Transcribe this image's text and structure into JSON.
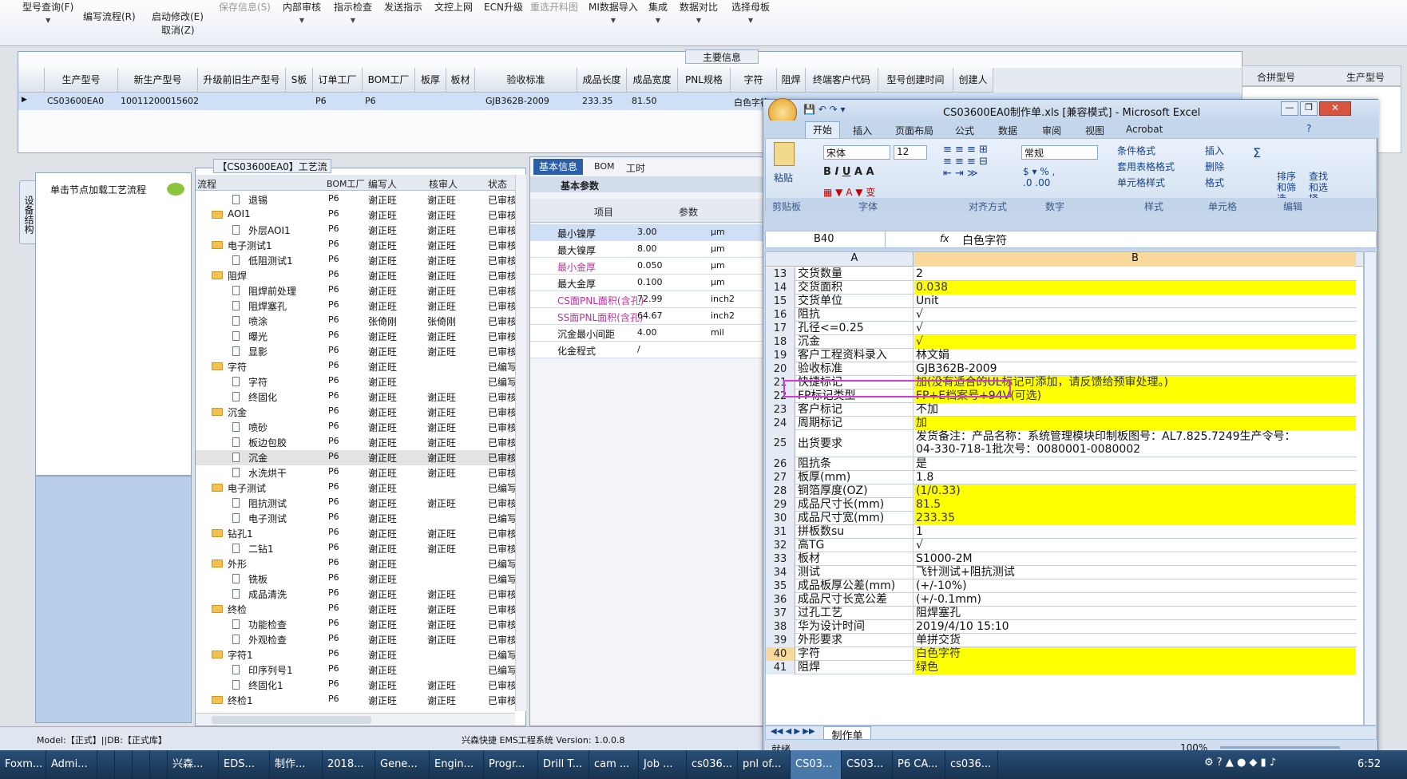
{
  "toolbar": {
    "items": [
      {
        "label": "型号查询(F)",
        "disabled": false
      },
      {
        "label": "编写流程(R)",
        "disabled": false
      },
      {
        "label": "启动修改(E)",
        "disabled": false
      },
      {
        "label": "取消(Z)",
        "disabled": false
      },
      {
        "label": "保存信息(S)",
        "disabled": true
      },
      {
        "label": "内部审核",
        "disabled": false
      },
      {
        "label": "指示检查",
        "disabled": false
      },
      {
        "label": "发送指示",
        "disabled": false
      },
      {
        "label": "文控上网",
        "disabled": false
      },
      {
        "label": "ECN升级",
        "disabled": false
      },
      {
        "label": "重选开料图",
        "disabled": true
      },
      {
        "label": "MI数据导入",
        "disabled": false
      },
      {
        "label": "集成",
        "disabled": false
      },
      {
        "label": "数据对比",
        "disabled": false
      },
      {
        "label": "选择母板",
        "disabled": false
      }
    ]
  },
  "main_info": {
    "title": "主要信息",
    "columns": [
      "生产型号",
      "新生产型号",
      "升级前旧生产型号",
      "S板",
      "订单工厂",
      "BOM工厂",
      "板厚",
      "板材",
      "验收标准",
      "成品长度",
      "成品宽度",
      "PNL规格",
      "字符",
      "阻焊",
      "终端客户代码",
      "型号创建时间",
      "创建人"
    ],
    "row": [
      "CS03600EA0",
      "10011200015602",
      "",
      "",
      "P6",
      "P6",
      "",
      "",
      "GJB362B-2009",
      "233.35",
      "81.50",
      "",
      "白色字符",
      "",
      "",
      "",
      ""
    ],
    "extra_columns": [
      "合拼型号",
      "生产型号"
    ]
  },
  "side_tab": "设备结构",
  "left_panel": {
    "hint": "单击节点加载工艺流程"
  },
  "process_flow": {
    "title": "【CS03600EA0】工艺流程",
    "columns": [
      "流程",
      "BOM工厂",
      "编写人",
      "核审人",
      "状态"
    ],
    "rows": [
      {
        "name": "退锡",
        "level": 2,
        "bom": "P6",
        "writer": "谢正旺",
        "reviewer": "谢正旺",
        "status": "已审核"
      },
      {
        "name": "AOI1",
        "level": 1,
        "bom": "P6",
        "writer": "谢正旺",
        "reviewer": "谢正旺",
        "status": "已审核"
      },
      {
        "name": "外层AOI1",
        "level": 2,
        "bom": "P6",
        "writer": "谢正旺",
        "reviewer": "谢正旺",
        "status": "已审核"
      },
      {
        "name": "电子测试1",
        "level": 1,
        "bom": "P6",
        "writer": "谢正旺",
        "reviewer": "谢正旺",
        "status": "已审核"
      },
      {
        "name": "低阻测试1",
        "level": 2,
        "bom": "P6",
        "writer": "谢正旺",
        "reviewer": "谢正旺",
        "status": "已审核"
      },
      {
        "name": "阻焊",
        "level": 1,
        "bom": "P6",
        "writer": "谢正旺",
        "reviewer": "谢正旺",
        "status": "已审核"
      },
      {
        "name": "阻焊前处理",
        "level": 2,
        "bom": "P6",
        "writer": "谢正旺",
        "reviewer": "谢正旺",
        "status": "已审核"
      },
      {
        "name": "阻焊塞孔",
        "level": 2,
        "bom": "P6",
        "writer": "谢正旺",
        "reviewer": "谢正旺",
        "status": "已审核"
      },
      {
        "name": "喷涂",
        "level": 2,
        "bom": "P6",
        "writer": "张倚刚",
        "reviewer": "张倚刚",
        "status": "已审核"
      },
      {
        "name": "曝光",
        "level": 2,
        "bom": "P6",
        "writer": "谢正旺",
        "reviewer": "谢正旺",
        "status": "已审核"
      },
      {
        "name": "显影",
        "level": 2,
        "bom": "P6",
        "writer": "谢正旺",
        "reviewer": "谢正旺",
        "status": "已审核"
      },
      {
        "name": "字符",
        "level": 1,
        "bom": "P6",
        "writer": "谢正旺",
        "reviewer": "",
        "status": "已编写"
      },
      {
        "name": "字符",
        "level": 2,
        "bom": "P6",
        "writer": "谢正旺",
        "reviewer": "",
        "status": "已编写"
      },
      {
        "name": "终固化",
        "level": 2,
        "bom": "P6",
        "writer": "谢正旺",
        "reviewer": "谢正旺",
        "status": "已审核"
      },
      {
        "name": "沉金",
        "level": 1,
        "bom": "P6",
        "writer": "谢正旺",
        "reviewer": "谢正旺",
        "status": "已审核"
      },
      {
        "name": "喷砂",
        "level": 2,
        "bom": "P6",
        "writer": "谢正旺",
        "reviewer": "谢正旺",
        "status": "已审核"
      },
      {
        "name": "板边包胶",
        "level": 2,
        "bom": "P6",
        "writer": "谢正旺",
        "reviewer": "谢正旺",
        "status": "已审核"
      },
      {
        "name": "沉金",
        "level": 2,
        "bom": "P6",
        "writer": "谢正旺",
        "reviewer": "谢正旺",
        "status": "已审核"
      },
      {
        "name": "水洗烘干",
        "level": 2,
        "bom": "P6",
        "writer": "谢正旺",
        "reviewer": "谢正旺",
        "status": "已审核"
      },
      {
        "name": "电子测试",
        "level": 1,
        "bom": "P6",
        "writer": "谢正旺",
        "reviewer": "",
        "status": "已编写"
      },
      {
        "name": "阻抗测试",
        "level": 2,
        "bom": "P6",
        "writer": "谢正旺",
        "reviewer": "谢正旺",
        "status": "已审核"
      },
      {
        "name": "电子测试",
        "level": 2,
        "bom": "P6",
        "writer": "谢正旺",
        "reviewer": "",
        "status": "已编写"
      },
      {
        "name": "钻孔1",
        "level": 1,
        "bom": "P6",
        "writer": "谢正旺",
        "reviewer": "谢正旺",
        "status": "已审核"
      },
      {
        "name": "二钻1",
        "level": 2,
        "bom": "P6",
        "writer": "谢正旺",
        "reviewer": "谢正旺",
        "status": "已审核"
      },
      {
        "name": "外形",
        "level": 1,
        "bom": "P6",
        "writer": "谢正旺",
        "reviewer": "",
        "status": "已编写"
      },
      {
        "name": "铣板",
        "level": 2,
        "bom": "P6",
        "writer": "谢正旺",
        "reviewer": "",
        "status": "已编写"
      },
      {
        "name": "成品清洗",
        "level": 2,
        "bom": "P6",
        "writer": "谢正旺",
        "reviewer": "谢正旺",
        "status": "已审核"
      },
      {
        "name": "终检",
        "level": 1,
        "bom": "P6",
        "writer": "谢正旺",
        "reviewer": "谢正旺",
        "status": "已审核"
      },
      {
        "name": "功能检查",
        "level": 2,
        "bom": "P6",
        "writer": "谢正旺",
        "reviewer": "谢正旺",
        "status": "已审核"
      },
      {
        "name": "外观检查",
        "level": 2,
        "bom": "P6",
        "writer": "谢正旺",
        "reviewer": "谢正旺",
        "status": "已审核"
      },
      {
        "name": "字符1",
        "level": 1,
        "bom": "P6",
        "writer": "谢正旺",
        "reviewer": "",
        "status": "已编写"
      },
      {
        "name": "印序列号1",
        "level": 2,
        "bom": "P6",
        "writer": "谢正旺",
        "reviewer": "",
        "status": "已编写"
      },
      {
        "name": "终固化1",
        "level": 2,
        "bom": "P6",
        "writer": "谢正旺",
        "reviewer": "谢正旺",
        "status": "已审核"
      },
      {
        "name": "终检1",
        "level": 1,
        "bom": "P6",
        "writer": "谢正旺",
        "reviewer": "谢正旺",
        "status": "已审核"
      }
    ],
    "selected_index": 17
  },
  "basic_info": {
    "tabs": [
      "基本信息",
      "BOM",
      "工时"
    ],
    "section": "基本参数",
    "columns": [
      "项目",
      "参数"
    ],
    "rows": [
      {
        "item": "最小镍厚",
        "value": "3.00",
        "unit": "μm",
        "pink": false
      },
      {
        "item": "最大镍厚",
        "value": "8.00",
        "unit": "μm",
        "pink": false
      },
      {
        "item": "最小金厚",
        "value": "0.050",
        "unit": "μm",
        "pink": true
      },
      {
        "item": "最大金厚",
        "value": "0.100",
        "unit": "μm",
        "pink": false
      },
      {
        "item": "CS面PNL面积(含孔)",
        "value": "72.99",
        "unit": "inch2",
        "pink": true
      },
      {
        "item": "SS面PNL面积(含孔)",
        "value": "64.67",
        "unit": "inch2",
        "pink": true
      },
      {
        "item": "沉金最小间距",
        "value": "4.00",
        "unit": "mil",
        "pink": false
      },
      {
        "item": "化金程式",
        "value": "/",
        "unit": "",
        "pink": false
      }
    ]
  },
  "status_bar": {
    "left": "Model:【正式】||DB:【正式库】",
    "center": "兴森快捷 EMS工程系统 Version: 1.0.0.8"
  },
  "excel": {
    "title": "CS03600EA0制作单.xls  [兼容模式] - Microsoft Excel",
    "tabs": [
      "开始",
      "插入",
      "页面布局",
      "公式",
      "数据",
      "审阅",
      "视图",
      "Acrobat"
    ],
    "font_name": "宋体",
    "font_size": "12",
    "number_format": "常规",
    "groups": [
      "剪贴板",
      "字体",
      "对齐方式",
      "数字",
      "样式",
      "单元格",
      "编辑"
    ],
    "paste": "粘贴",
    "styles_items": [
      "条件格式",
      "套用表格格式",
      "单元格样式"
    ],
    "cells_items": [
      "插入",
      "删除",
      "格式"
    ],
    "edit_items": [
      "排序和筛选",
      "查找和选择"
    ],
    "name_box": "B40",
    "formula": "白色字符",
    "col_a": "A",
    "col_b": "B",
    "rows": [
      {
        "n": "13",
        "a": "交货数量",
        "b": "2",
        "yellow": false
      },
      {
        "n": "14",
        "a": "交货面积",
        "b": "0.038",
        "yellow": true
      },
      {
        "n": "15",
        "a": "交货单位",
        "b": "Unit",
        "yellow": false
      },
      {
        "n": "16",
        "a": "阻抗",
        "b": "√",
        "yellow": false
      },
      {
        "n": "17",
        "a": "孔径<=0.25",
        "b": "√",
        "yellow": false
      },
      {
        "n": "18",
        "a": "沉金",
        "b": "√",
        "yellow": true
      },
      {
        "n": "19",
        "a": "客户工程资料录入",
        "b": "林文娟",
        "yellow": false
      },
      {
        "n": "20",
        "a": "验收标准",
        "b": "GJB362B-2009",
        "yellow": false
      },
      {
        "n": "21",
        "a": "快捷标记",
        "b": "加(没有适合的UL标记可添加，请反馈给预审处理。)",
        "yellow": true
      },
      {
        "n": "22",
        "a": "FP标记类型",
        "b": "FP+E档案号+94V(可选)",
        "yellow": true
      },
      {
        "n": "23",
        "a": "客户标记",
        "b": "不加",
        "yellow": false
      },
      {
        "n": "24",
        "a": "周期标记",
        "b": "加",
        "yellow": true
      },
      {
        "n": "25",
        "a": "出货要求",
        "b": "发货备注：产品名称：系统管理模块印制板图号：AL7.825.7249生产令号：",
        "b2": "04-330-718-1批次号：0080001-0080002",
        "yellow": false,
        "tall": true
      },
      {
        "n": "26",
        "a": "阻抗条",
        "b": "是",
        "yellow": false
      },
      {
        "n": "27",
        "a": "板厚(mm)",
        "b": "1.8",
        "yellow": false
      },
      {
        "n": "28",
        "a": "铜箔厚度(OZ)",
        "b": "(1/0.33)",
        "yellow": true
      },
      {
        "n": "29",
        "a": "成品尺寸长(mm)",
        "b": "81.5",
        "yellow": true
      },
      {
        "n": "30",
        "a": "成品尺寸宽(mm)",
        "b": "233.35",
        "yellow": true
      },
      {
        "n": "31",
        "a": "拼板数su",
        "b": "1",
        "yellow": false
      },
      {
        "n": "32",
        "a": "高TG",
        "b": "√",
        "yellow": false
      },
      {
        "n": "33",
        "a": "板材",
        "b": "S1000-2M",
        "yellow": false
      },
      {
        "n": "34",
        "a": "测试",
        "b": "飞针测试+阻抗测试",
        "yellow": false
      },
      {
        "n": "35",
        "a": "成品板厚公差(mm)",
        "b": "(+/-10%)",
        "yellow": false
      },
      {
        "n": "36",
        "a": "成品尺寸长宽公差",
        "b": "(+/-0.1mm)",
        "yellow": false
      },
      {
        "n": "37",
        "a": "过孔工艺",
        "b": "阻焊塞孔",
        "yellow": false
      },
      {
        "n": "38",
        "a": "华为设计时间",
        "b": "2019/4/10 15:10",
        "yellow": false
      },
      {
        "n": "39",
        "a": "外形要求",
        "b": "单拼交货",
        "yellow": false
      },
      {
        "n": "40",
        "a": "字符",
        "b": "白色字符",
        "yellow": true
      },
      {
        "n": "41",
        "a": "阻焊",
        "b": "绿色",
        "yellow": true
      }
    ],
    "sheet_tab": "制作单",
    "status": "就绪",
    "zoom": "100%"
  },
  "taskbar": {
    "items": [
      "Foxm...",
      "Admi...",
      "",
      "",
      "",
      "",
      "兴森...",
      "EDS...",
      "制作...",
      "2018...",
      "Gene...",
      "Engin...",
      "Progr...",
      "Drill T...",
      "cam ...",
      "Job ...",
      "cs036...",
      "pnl of...",
      "CS03...",
      "CS03...",
      "P6 CA...",
      "cs036..."
    ],
    "time": "6:52"
  }
}
